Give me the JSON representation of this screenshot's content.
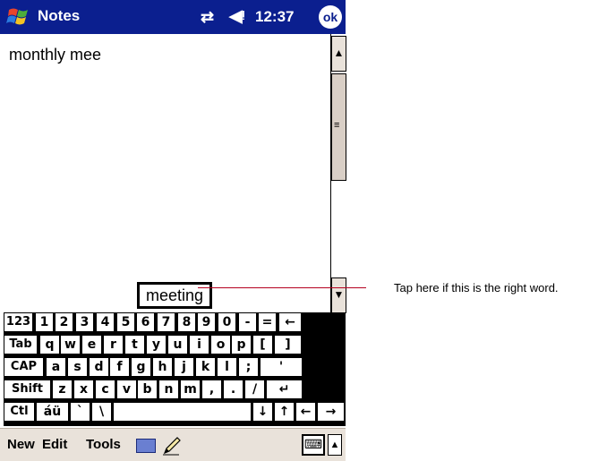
{
  "titlebar": {
    "title": "Notes",
    "time": "12:37",
    "ok": "ok",
    "start_icon": "windows-flag-icon",
    "connectivity_icon": "connectivity-icon",
    "volume_icon": "speaker-icon"
  },
  "note": {
    "text": "monthly mee"
  },
  "suggestion": {
    "word": "meeting"
  },
  "callout": {
    "text": "Tap here if this is the right word."
  },
  "keyboard": {
    "rows": [
      [
        "123",
        "1",
        "2",
        "3",
        "4",
        "5",
        "6",
        "7",
        "8",
        "9",
        "0",
        "-",
        "=",
        "←"
      ],
      [
        "Tab",
        "q",
        "w",
        "e",
        "r",
        "t",
        "y",
        "u",
        "i",
        "o",
        "p",
        "[",
        "]"
      ],
      [
        "CAP",
        "a",
        "s",
        "d",
        "f",
        "g",
        "h",
        "j",
        "k",
        "l",
        ";",
        "'"
      ],
      [
        "Shift",
        "z",
        "x",
        "c",
        "v",
        "b",
        "n",
        "m",
        ",",
        ".",
        "/",
        "↵"
      ],
      [
        "Ctl",
        "áü",
        "`",
        "\\",
        "",
        "↓",
        "↑",
        "←",
        "→"
      ]
    ]
  },
  "menubar": {
    "new": "New",
    "edit": "Edit",
    "tools": "Tools",
    "up_arrow": "▲"
  },
  "colors": {
    "titlebar": "#0b1f8f",
    "menubar": "#e9e2da",
    "pointer": "#b50020"
  }
}
